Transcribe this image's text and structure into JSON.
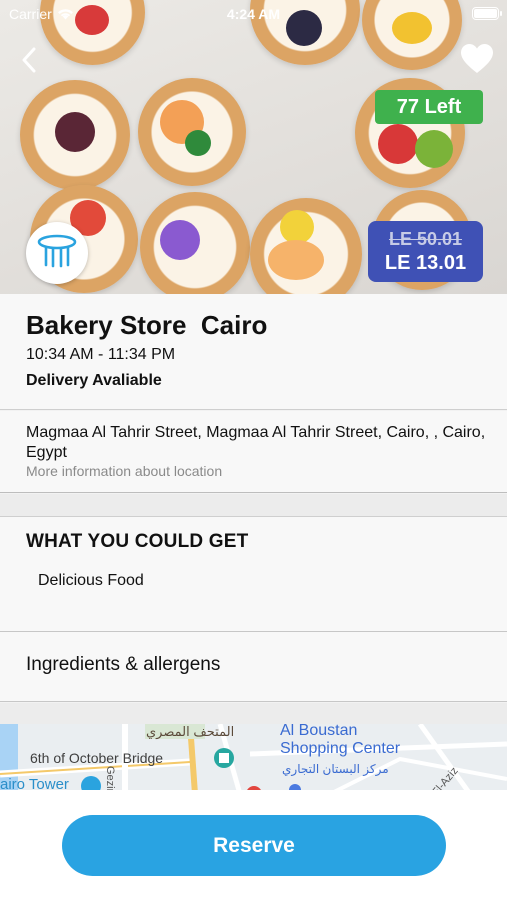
{
  "status_bar": {
    "carrier": "Carrier",
    "time": "4:24 AM"
  },
  "offer": {
    "items_left": "77  Left",
    "old_price": "LE 50.01",
    "new_price": "LE 13.01"
  },
  "store": {
    "name": "Bakery Store  Cairo",
    "hours": "10:34 AM - 11:34 PM",
    "delivery": "Delivery Avaliable"
  },
  "location": {
    "address": "Magmaa Al Tahrir Street, Magmaa Al Tahrir Street, Cairo, , Cairo, Egypt",
    "more_info": "More information about location"
  },
  "what_you_get": {
    "title": "WHAT YOU COULD GET",
    "item": "Delicious Food"
  },
  "ingredients": {
    "label": "Ingredients & allergens"
  },
  "map": {
    "label_museum_ar": "المتحف المصري",
    "label_boustan": "Al Boustan",
    "label_shopping": "Shopping Center",
    "label_bridge": "6th of October Bridge",
    "label_boustan_ar": "مركز البستان التجاري",
    "label_tower": "airo Tower",
    "label_gezira": "Gezira",
    "label_aziz": "El-Aziz"
  },
  "actions": {
    "reserve": "Reserve"
  },
  "colors": {
    "accent": "#29a3e2",
    "price_badge": "#3f51b5",
    "left_badge": "#3fb14d"
  }
}
